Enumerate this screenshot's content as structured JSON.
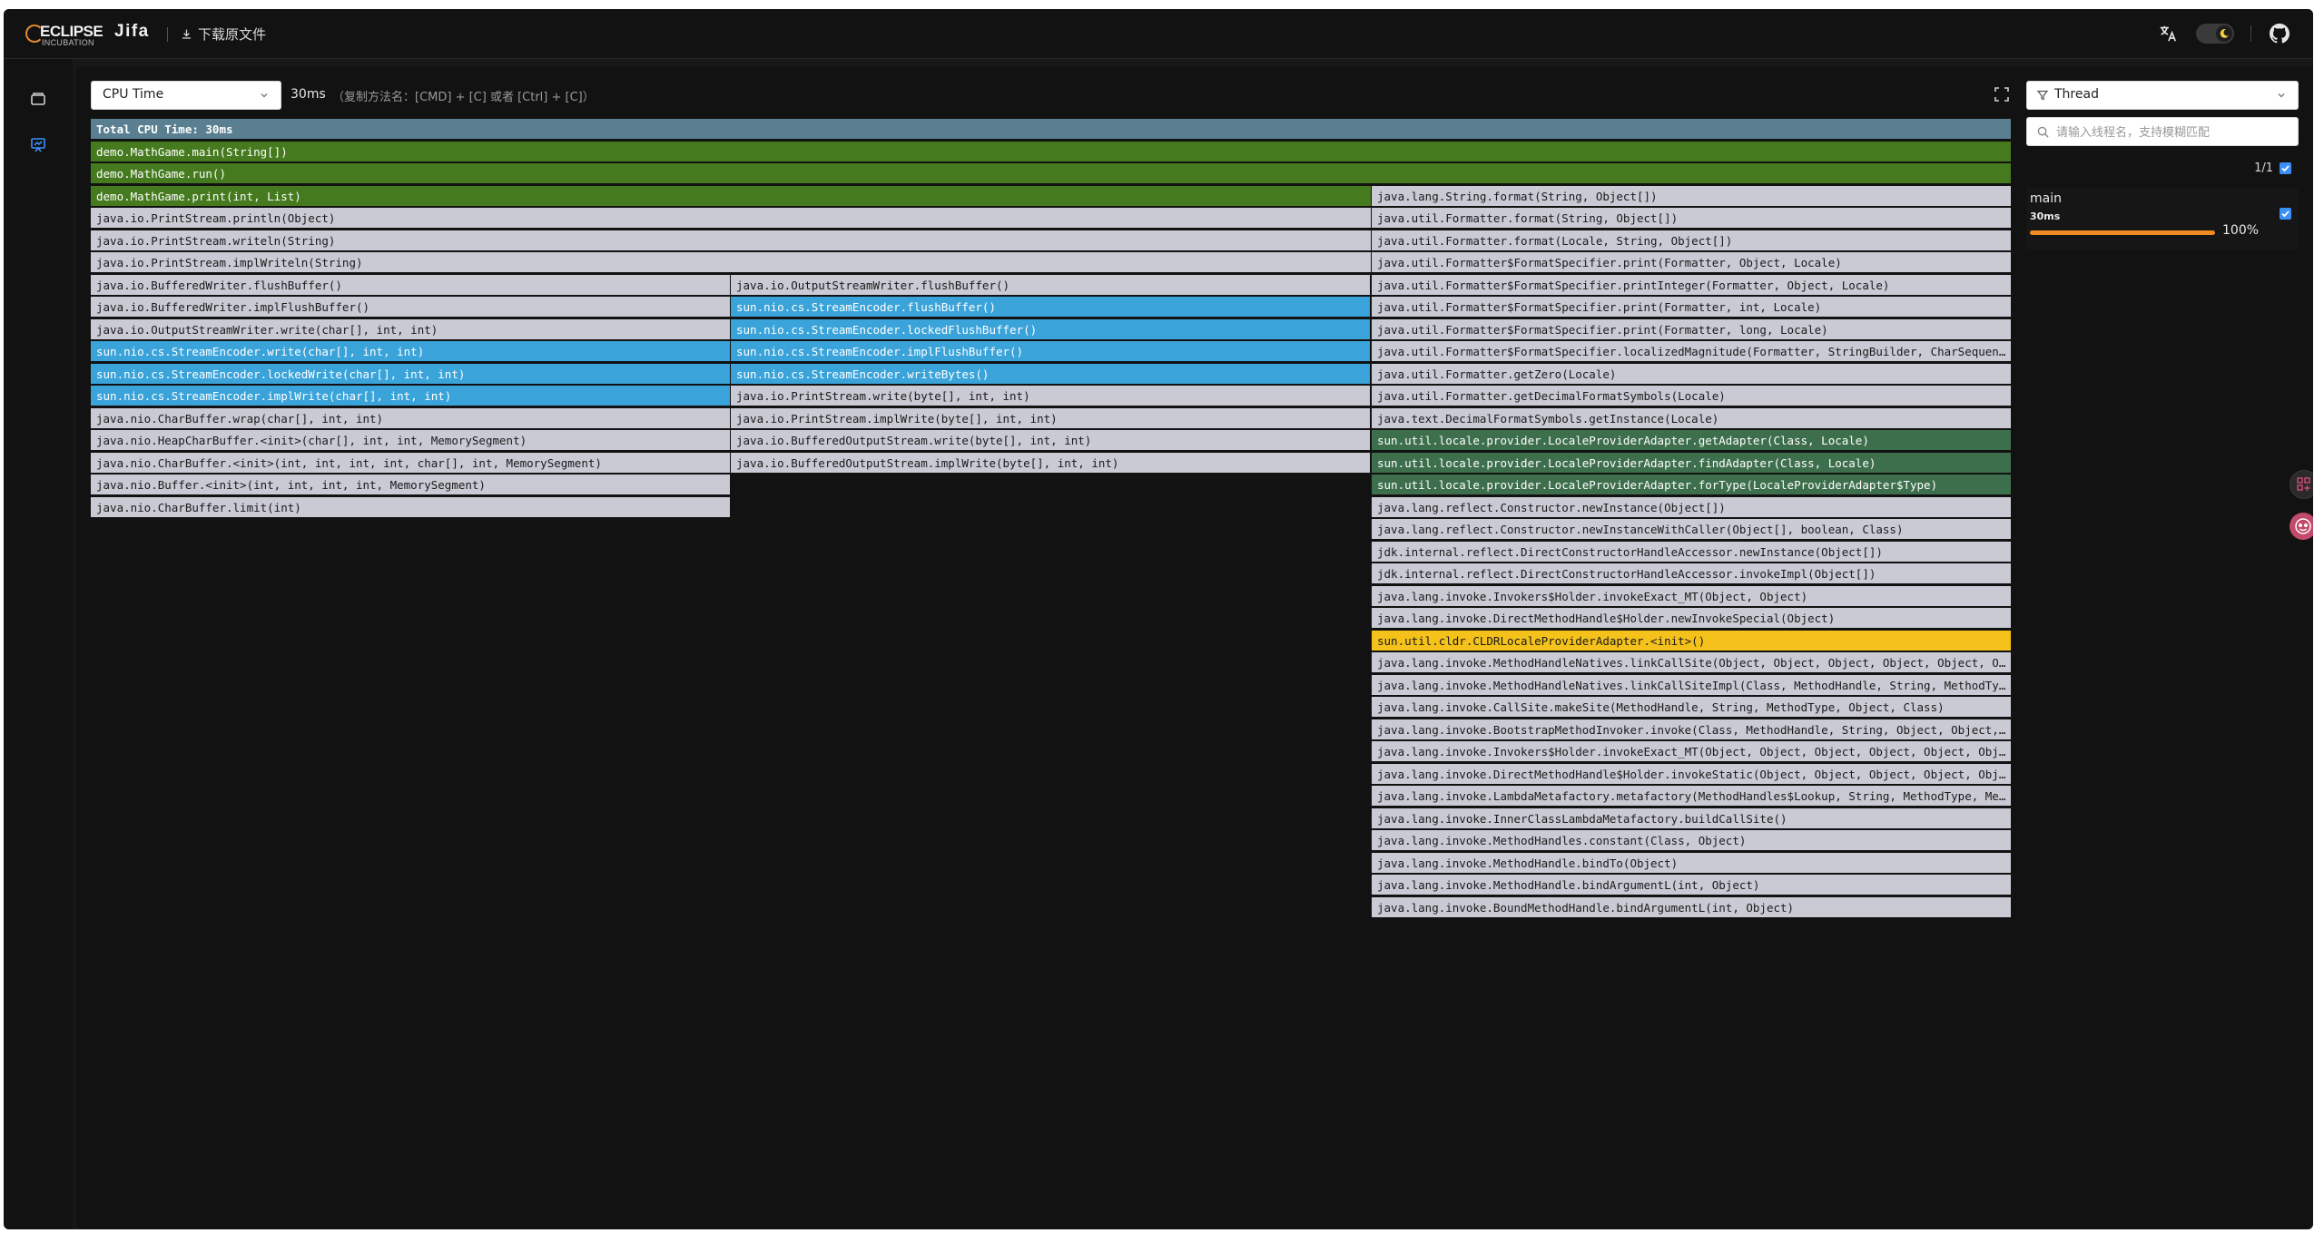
{
  "header": {
    "logo_main": "ECLIPSE",
    "logo_sub": "INCUBATION",
    "app_name": "Jifa",
    "download_label": "下载原文件"
  },
  "toolbar": {
    "dimension_selected": "CPU Time",
    "total_value": "30ms",
    "copy_hint": "（复制方法名：[CMD] + [C] 或者 [Ctrl] + [C]）"
  },
  "thread_panel": {
    "filter_selected": "Thread",
    "search_placeholder": "请输入线程名，支持模糊匹配",
    "count": "1/1",
    "threads": [
      {
        "name": "main",
        "time": "30ms",
        "percent": "100%",
        "fraction": 1.0,
        "checked": true
      }
    ]
  },
  "flame": {
    "colors": {
      "header": "#5a7f91",
      "green": "#457a1f",
      "blue": "#3aa3d9",
      "darkgreen": "#3e6f4d",
      "gray": "#c9cad4",
      "yellow": "#f4c21a"
    },
    "frames": [
      {
        "label": "Total CPU Time: 30ms",
        "depth": 0,
        "start": 0,
        "width": 1,
        "color": "header"
      },
      {
        "label": "demo.MathGame.main(String[])",
        "depth": 1,
        "start": 0,
        "width": 1,
        "color": "green"
      },
      {
        "label": "demo.MathGame.run()",
        "depth": 2,
        "start": 0,
        "width": 1,
        "color": "green"
      },
      {
        "label": "demo.MathGame.print(int, List)",
        "depth": 3,
        "start": 0,
        "width": 0.6667,
        "color": "green"
      },
      {
        "label": "java.lang.String.format(String, Object[])",
        "depth": 3,
        "start": 0.6667,
        "width": 0.3333,
        "color": "gray"
      },
      {
        "label": "java.io.PrintStream.println(Object)",
        "depth": 4,
        "start": 0,
        "width": 0.6667,
        "color": "gray"
      },
      {
        "label": "java.util.Formatter.format(String, Object[])",
        "depth": 4,
        "start": 0.6667,
        "width": 0.3333,
        "color": "gray"
      },
      {
        "label": "java.io.PrintStream.writeln(String)",
        "depth": 5,
        "start": 0,
        "width": 0.6667,
        "color": "gray"
      },
      {
        "label": "java.util.Formatter.format(Locale, String, Object[])",
        "depth": 5,
        "start": 0.6667,
        "width": 0.3333,
        "color": "gray"
      },
      {
        "label": "java.io.PrintStream.implWriteln(String)",
        "depth": 6,
        "start": 0,
        "width": 0.6667,
        "color": "gray"
      },
      {
        "label": "java.util.Formatter$FormatSpecifier.print(Formatter, Object, Locale)",
        "depth": 6,
        "start": 0.6667,
        "width": 0.3333,
        "color": "gray"
      },
      {
        "label": "java.io.BufferedWriter.flushBuffer()",
        "depth": 7,
        "start": 0,
        "width": 0.3333,
        "color": "gray"
      },
      {
        "label": "java.io.OutputStreamWriter.flushBuffer()",
        "depth": 7,
        "start": 0.3333,
        "width": 0.3333,
        "color": "gray"
      },
      {
        "label": "java.util.Formatter$FormatSpecifier.printInteger(Formatter, Object, Locale)",
        "depth": 7,
        "start": 0.6667,
        "width": 0.3333,
        "color": "gray"
      },
      {
        "label": "java.io.BufferedWriter.implFlushBuffer()",
        "depth": 8,
        "start": 0,
        "width": 0.3333,
        "color": "gray"
      },
      {
        "label": "sun.nio.cs.StreamEncoder.flushBuffer()",
        "depth": 8,
        "start": 0.3333,
        "width": 0.3333,
        "color": "blue"
      },
      {
        "label": "java.util.Formatter$FormatSpecifier.print(Formatter, int, Locale)",
        "depth": 8,
        "start": 0.6667,
        "width": 0.3333,
        "color": "gray"
      },
      {
        "label": "java.io.OutputStreamWriter.write(char[], int, int)",
        "depth": 9,
        "start": 0,
        "width": 0.3333,
        "color": "gray"
      },
      {
        "label": "sun.nio.cs.StreamEncoder.lockedFlushBuffer()",
        "depth": 9,
        "start": 0.3333,
        "width": 0.3333,
        "color": "blue"
      },
      {
        "label": "java.util.Formatter$FormatSpecifier.print(Formatter, long, Locale)",
        "depth": 9,
        "start": 0.6667,
        "width": 0.3333,
        "color": "gray"
      },
      {
        "label": "sun.nio.cs.StreamEncoder.write(char[], int, int)",
        "depth": 10,
        "start": 0,
        "width": 0.3333,
        "color": "blue"
      },
      {
        "label": "sun.nio.cs.StreamEncoder.implFlushBuffer()",
        "depth": 10,
        "start": 0.3333,
        "width": 0.3333,
        "color": "blue"
      },
      {
        "label": "java.util.Formatter$FormatSpecifier.localizedMagnitude(Formatter, StringBuilder, CharSequenc...",
        "depth": 10,
        "start": 0.6667,
        "width": 0.3333,
        "color": "gray"
      },
      {
        "label": "sun.nio.cs.StreamEncoder.lockedWrite(char[], int, int)",
        "depth": 11,
        "start": 0,
        "width": 0.3333,
        "color": "blue"
      },
      {
        "label": "sun.nio.cs.StreamEncoder.writeBytes()",
        "depth": 11,
        "start": 0.3333,
        "width": 0.3333,
        "color": "blue"
      },
      {
        "label": "java.util.Formatter.getZero(Locale)",
        "depth": 11,
        "start": 0.6667,
        "width": 0.3333,
        "color": "gray"
      },
      {
        "label": "sun.nio.cs.StreamEncoder.implWrite(char[], int, int)",
        "depth": 12,
        "start": 0,
        "width": 0.3333,
        "color": "blue"
      },
      {
        "label": "java.io.PrintStream.write(byte[], int, int)",
        "depth": 12,
        "start": 0.3333,
        "width": 0.3333,
        "color": "gray"
      },
      {
        "label": "java.util.Formatter.getDecimalFormatSymbols(Locale)",
        "depth": 12,
        "start": 0.6667,
        "width": 0.3333,
        "color": "gray"
      },
      {
        "label": "java.nio.CharBuffer.wrap(char[], int, int)",
        "depth": 13,
        "start": 0,
        "width": 0.3333,
        "color": "gray"
      },
      {
        "label": "java.io.PrintStream.implWrite(byte[], int, int)",
        "depth": 13,
        "start": 0.3333,
        "width": 0.3333,
        "color": "gray"
      },
      {
        "label": "java.text.DecimalFormatSymbols.getInstance(Locale)",
        "depth": 13,
        "start": 0.6667,
        "width": 0.3333,
        "color": "gray"
      },
      {
        "label": "java.nio.HeapCharBuffer.<init>(char[], int, int, MemorySegment)",
        "depth": 14,
        "start": 0,
        "width": 0.3333,
        "color": "gray"
      },
      {
        "label": "java.io.BufferedOutputStream.write(byte[], int, int)",
        "depth": 14,
        "start": 0.3333,
        "width": 0.3333,
        "color": "gray"
      },
      {
        "label": "sun.util.locale.provider.LocaleProviderAdapter.getAdapter(Class, Locale)",
        "depth": 14,
        "start": 0.6667,
        "width": 0.3333,
        "color": "darkgreen"
      },
      {
        "label": "java.nio.CharBuffer.<init>(int, int, int, int, char[], int, MemorySegment)",
        "depth": 15,
        "start": 0,
        "width": 0.3333,
        "color": "gray"
      },
      {
        "label": "java.io.BufferedOutputStream.implWrite(byte[], int, int)",
        "depth": 15,
        "start": 0.3333,
        "width": 0.3333,
        "color": "gray"
      },
      {
        "label": "sun.util.locale.provider.LocaleProviderAdapter.findAdapter(Class, Locale)",
        "depth": 15,
        "start": 0.6667,
        "width": 0.3333,
        "color": "darkgreen"
      },
      {
        "label": "java.nio.Buffer.<init>(int, int, int, int, MemorySegment)",
        "depth": 16,
        "start": 0,
        "width": 0.3333,
        "color": "gray"
      },
      {
        "label": "sun.util.locale.provider.LocaleProviderAdapter.forType(LocaleProviderAdapter$Type)",
        "depth": 16,
        "start": 0.6667,
        "width": 0.3333,
        "color": "darkgreen"
      },
      {
        "label": "java.nio.CharBuffer.limit(int)",
        "depth": 17,
        "start": 0,
        "width": 0.3333,
        "color": "gray"
      },
      {
        "label": "java.lang.reflect.Constructor.newInstance(Object[])",
        "depth": 17,
        "start": 0.6667,
        "width": 0.3333,
        "color": "gray"
      },
      {
        "label": "java.lang.reflect.Constructor.newInstanceWithCaller(Object[], boolean, Class)",
        "depth": 18,
        "start": 0.6667,
        "width": 0.3333,
        "color": "gray"
      },
      {
        "label": "jdk.internal.reflect.DirectConstructorHandleAccessor.newInstance(Object[])",
        "depth": 19,
        "start": 0.6667,
        "width": 0.3333,
        "color": "gray"
      },
      {
        "label": "jdk.internal.reflect.DirectConstructorHandleAccessor.invokeImpl(Object[])",
        "depth": 20,
        "start": 0.6667,
        "width": 0.3333,
        "color": "gray"
      },
      {
        "label": "java.lang.invoke.Invokers$Holder.invokeExact_MT(Object, Object)",
        "depth": 21,
        "start": 0.6667,
        "width": 0.3333,
        "color": "gray"
      },
      {
        "label": "java.lang.invoke.DirectMethodHandle$Holder.newInvokeSpecial(Object)",
        "depth": 22,
        "start": 0.6667,
        "width": 0.3333,
        "color": "gray"
      },
      {
        "label": "sun.util.cldr.CLDRLocaleProviderAdapter.<init>()",
        "depth": 23,
        "start": 0.6667,
        "width": 0.3333,
        "color": "yellow"
      },
      {
        "label": "java.lang.invoke.MethodHandleNatives.linkCallSite(Object, Object, Object, Object, Object, Ob...",
        "depth": 24,
        "start": 0.6667,
        "width": 0.3333,
        "color": "gray"
      },
      {
        "label": "java.lang.invoke.MethodHandleNatives.linkCallSiteImpl(Class, MethodHandle, String, MethodTyp...",
        "depth": 25,
        "start": 0.6667,
        "width": 0.3333,
        "color": "gray"
      },
      {
        "label": "java.lang.invoke.CallSite.makeSite(MethodHandle, String, MethodType, Object, Class)",
        "depth": 26,
        "start": 0.6667,
        "width": 0.3333,
        "color": "gray"
      },
      {
        "label": "java.lang.invoke.BootstrapMethodInvoker.invoke(Class, MethodHandle, String, Object, Object, ...",
        "depth": 27,
        "start": 0.6667,
        "width": 0.3333,
        "color": "gray"
      },
      {
        "label": "java.lang.invoke.Invokers$Holder.invokeExact_MT(Object, Object, Object, Object, Object, Obje...",
        "depth": 28,
        "start": 0.6667,
        "width": 0.3333,
        "color": "gray"
      },
      {
        "label": "java.lang.invoke.DirectMethodHandle$Holder.invokeStatic(Object, Object, Object, Object, Obje...",
        "depth": 29,
        "start": 0.6667,
        "width": 0.3333,
        "color": "gray"
      },
      {
        "label": "java.lang.invoke.LambdaMetafactory.metafactory(MethodHandles$Lookup, String, MethodType, Met...",
        "depth": 30,
        "start": 0.6667,
        "width": 0.3333,
        "color": "gray"
      },
      {
        "label": "java.lang.invoke.InnerClassLambdaMetafactory.buildCallSite()",
        "depth": 31,
        "start": 0.6667,
        "width": 0.3333,
        "color": "gray"
      },
      {
        "label": "java.lang.invoke.MethodHandles.constant(Class, Object)",
        "depth": 32,
        "start": 0.6667,
        "width": 0.3333,
        "color": "gray"
      },
      {
        "label": "java.lang.invoke.MethodHandle.bindTo(Object)",
        "depth": 33,
        "start": 0.6667,
        "width": 0.3333,
        "color": "gray"
      },
      {
        "label": "java.lang.invoke.MethodHandle.bindArgumentL(int, Object)",
        "depth": 34,
        "start": 0.6667,
        "width": 0.3333,
        "color": "gray"
      },
      {
        "label": "java.lang.invoke.BoundMethodHandle.bindArgumentL(int, Object)",
        "depth": 35,
        "start": 0.6667,
        "width": 0.3333,
        "color": "gray"
      }
    ]
  }
}
